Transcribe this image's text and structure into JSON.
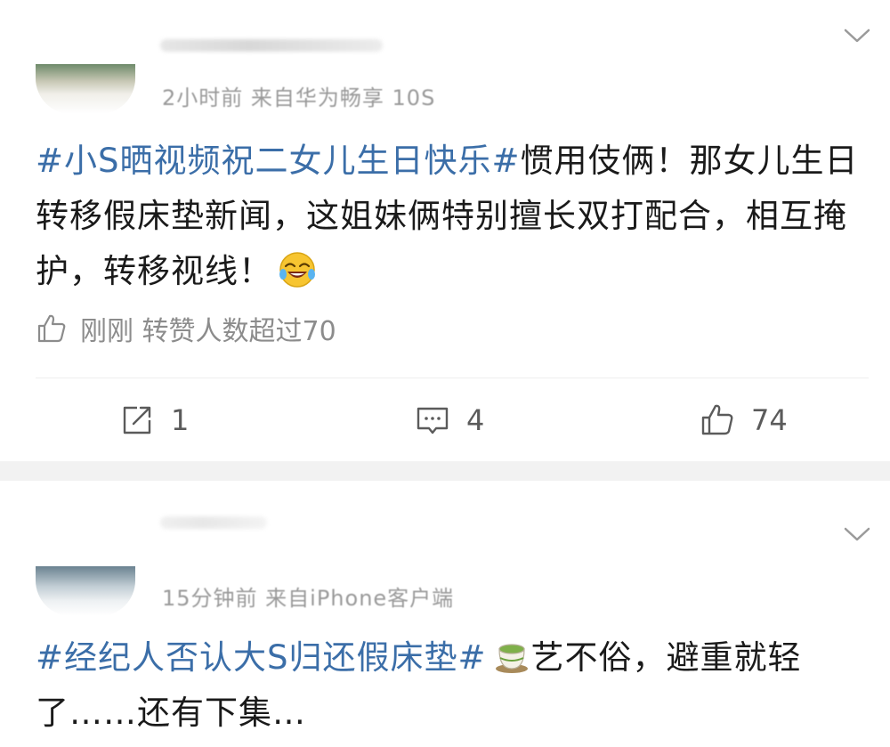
{
  "posts": [
    {
      "meta": "2小时前 来自华为畅享 10S",
      "content": {
        "hashtag": "#小S晒视频祝二女儿生日快乐#",
        "text": "惯用伎俩！那女儿生日转移假床垫新闻，这姐妹俩特别擅长双打配合，相互掩护，转移视线！",
        "emoji": "laughing-crying-emoji"
      },
      "liked_by_text": "刚刚 转赞人数超过70",
      "actions": {
        "repost_count": "1",
        "comment_count": "4",
        "like_count": "74"
      }
    },
    {
      "meta": "15分钟前 来自iPhone客户端",
      "content": {
        "hashtag": "#经纪人否认大S归还假床垫#",
        "emoji": "tea-emoji",
        "text": "艺不俗，避重就轻了……还有下集…"
      }
    }
  ],
  "colors": {
    "hashtag": "#3b6ea8",
    "meta": "#9a9a9a",
    "separator": "#f2f2f2"
  }
}
